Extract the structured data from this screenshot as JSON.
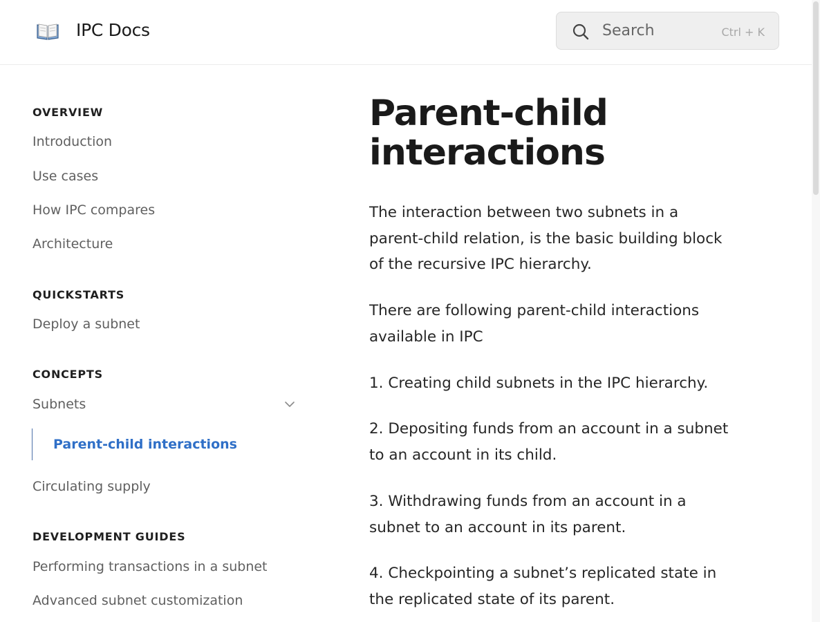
{
  "header": {
    "brand": "IPC Docs",
    "search_label": "Search",
    "search_shortcut": "Ctrl + K",
    "logo_icon": "open-book-icon",
    "search_icon": "search-icon"
  },
  "sidebar": {
    "sections": [
      {
        "title": "OVERVIEW",
        "items": [
          "Introduction",
          "Use cases",
          "How IPC compares",
          "Architecture"
        ]
      },
      {
        "title": "QUICKSTARTS",
        "items": [
          "Deploy a subnet"
        ]
      },
      {
        "title": "CONCEPTS",
        "items": [
          "Subnets",
          "Parent-child interactions",
          "Circulating supply"
        ]
      },
      {
        "title": "DEVELOPMENT GUIDES",
        "items": [
          "Performing transactions in a subnet",
          "Advanced subnet customization"
        ]
      }
    ],
    "active_item": "Parent-child interactions",
    "accent_color": "#2f6fc7"
  },
  "main": {
    "title": "Parent-child interactions",
    "paragraphs": [
      "The interaction between two subnets in a parent-child relation, is the basic building block of the recursive IPC hierarchy.",
      "There are following parent-child interactions available in IPC",
      "1. Creating child subnets in the IPC hierarchy.",
      "2. Depositing funds from an account in a subnet to an account in its child.",
      "3. Withdrawing funds from an account in a subnet to an account in its parent.",
      "4. Checkpointing a subnet’s replicated state in the replicated state of its parent."
    ]
  }
}
